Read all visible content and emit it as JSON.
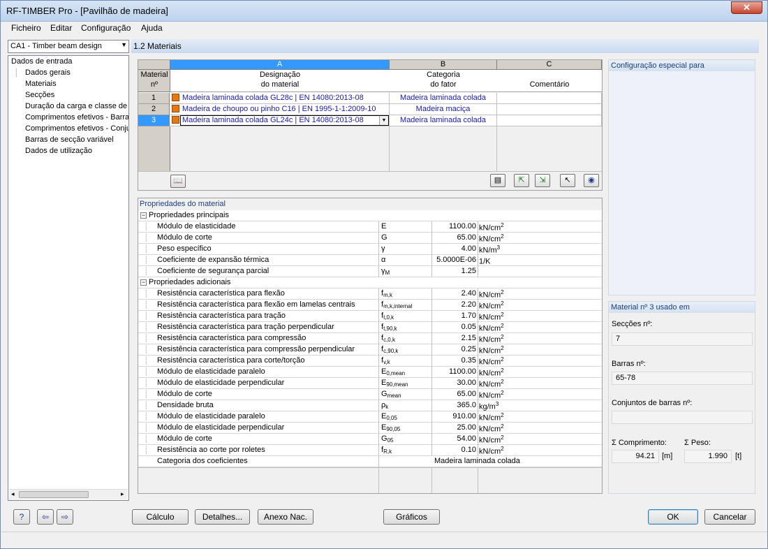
{
  "window": {
    "title": "RF-TIMBER Pro - [Pavilhão de madeira]"
  },
  "menu": [
    "Ficheiro",
    "Editar",
    "Configuração",
    "Ajuda"
  ],
  "nav": {
    "case": "CA1 - Timber beam design",
    "root": "Dados de entrada",
    "items": [
      "Dados gerais",
      "Materiais",
      "Secções",
      "Duração da carga e classe de u",
      "Comprimentos efetivos - Barras",
      "Comprimentos efetivos - Conju",
      "Barras de secção variável",
      "Dados de utilização"
    ]
  },
  "section_title": "1.2 Materiais",
  "grid": {
    "col_letters": [
      "A",
      "B",
      "C"
    ],
    "rownum_header": [
      "Material",
      "nº"
    ],
    "col_a_header": [
      "Designação",
      "do material"
    ],
    "col_b_header": [
      "Categoria",
      "do fator"
    ],
    "col_c_header": "Comentário",
    "rows": [
      {
        "num": "1",
        "material": "Madeira laminada colada GL28c | EN 14080:2013-08",
        "category": "Madeira laminada colada",
        "comment": ""
      },
      {
        "num": "2",
        "material": "Madeira de choupo ou pinho C16 | EN 1995-1-1:2009-10",
        "category": "Madeira maciça",
        "comment": ""
      },
      {
        "num": "3",
        "material": "Madeira laminada colada GL24c | EN 14080:2013-08",
        "category": "Madeira laminada colada",
        "comment": ""
      }
    ],
    "selected_row": 3,
    "swatch_color": "#e9770f"
  },
  "props": {
    "title": "Propriedades do material",
    "group_main": "Propriedades principais",
    "main": [
      {
        "name": "Módulo de elasticidade",
        "sym": "E",
        "sub": "",
        "value": "1100.00",
        "unit": "kN/cm",
        "exp": "2"
      },
      {
        "name": "Módulo de corte",
        "sym": "G",
        "sub": "",
        "value": "65.00",
        "unit": "kN/cm",
        "exp": "2"
      },
      {
        "name": "Peso específico",
        "sym": "γ",
        "sub": "",
        "value": "4.00",
        "unit": "kN/m",
        "exp": "3"
      },
      {
        "name": "Coeficiente de expansão térmica",
        "sym": "α",
        "sub": "",
        "value": "5.0000E-06",
        "unit": "1/K",
        "exp": ""
      },
      {
        "name": "Coeficiente de segurança parcial",
        "sym": "γ",
        "sub": "M",
        "value": "1.25",
        "unit": "",
        "exp": ""
      }
    ],
    "group_add": "Propriedades adicionais",
    "additional": [
      {
        "name": "Resistência característica para flexão",
        "sym": "f",
        "sub": "m,k",
        "value": "2.40",
        "unit": "kN/cm",
        "exp": "2"
      },
      {
        "name": "Resistência característica para flexão em lamelas centrais",
        "sym": "f",
        "sub": "m,k,internal",
        "value": "2.20",
        "unit": "kN/cm",
        "exp": "2"
      },
      {
        "name": "Resistência característica para tração",
        "sym": "f",
        "sub": "t,0,k",
        "value": "1.70",
        "unit": "kN/cm",
        "exp": "2"
      },
      {
        "name": "Resistência característica para tração perpendicular",
        "sym": "f",
        "sub": "t,90,k",
        "value": "0.05",
        "unit": "kN/cm",
        "exp": "2"
      },
      {
        "name": "Resistência característica para compressão",
        "sym": "f",
        "sub": "c,0,k",
        "value": "2.15",
        "unit": "kN/cm",
        "exp": "2"
      },
      {
        "name": "Resistência característica para compressão perpendicular",
        "sym": "f",
        "sub": "c,90,k",
        "value": "0.25",
        "unit": "kN/cm",
        "exp": "2"
      },
      {
        "name": "Resistência característica para corte/torção",
        "sym": "f",
        "sub": "v,k",
        "value": "0.35",
        "unit": "kN/cm",
        "exp": "2"
      },
      {
        "name": "Módulo de elasticidade paralelo",
        "sym": "E",
        "sub": "0,mean",
        "value": "1100.00",
        "unit": "kN/cm",
        "exp": "2"
      },
      {
        "name": "Módulo de elasticidade perpendicular",
        "sym": "E",
        "sub": "90,mean",
        "value": "30.00",
        "unit": "kN/cm",
        "exp": "2"
      },
      {
        "name": "Módulo de corte",
        "sym": "G",
        "sub": "mean",
        "value": "65.00",
        "unit": "kN/cm",
        "exp": "2"
      },
      {
        "name": "Densidade bruta",
        "sym": "ρ",
        "sub": "k",
        "value": "365.0",
        "unit": "kg/m",
        "exp": "3"
      },
      {
        "name": "Módulo de elasticidade paralelo",
        "sym": "E",
        "sub": "0,05",
        "value": "910.00",
        "unit": "kN/cm",
        "exp": "2"
      },
      {
        "name": "Módulo de elasticidade perpendicular",
        "sym": "E",
        "sub": "90,05",
        "value": "25.00",
        "unit": "kN/cm",
        "exp": "2"
      },
      {
        "name": "Módulo de corte",
        "sym": "G",
        "sub": "05",
        "value": "54.00",
        "unit": "kN/cm",
        "exp": "2"
      },
      {
        "name": "Resistência ao corte por roletes",
        "sym": "f",
        "sub": "R,k",
        "value": "0.10",
        "unit": "kN/cm",
        "exp": "2"
      }
    ],
    "category_row": {
      "name": "Categoria dos coeficientes",
      "value": "Madeira laminada colada"
    }
  },
  "right": {
    "config_title": "Configuração especial para",
    "usage_title": "Material nº 3 usado em",
    "sections_label": "Secções nº:",
    "sections_value": "7",
    "members_label": "Barras nº:",
    "members_value": "65-78",
    "sets_label": "Conjuntos de barras nº:",
    "sets_value": "",
    "length_label": "Σ Comprimento:",
    "length_value": "94.21",
    "length_unit": "[m]",
    "weight_label": "Σ Peso:",
    "weight_value": "1.990",
    "weight_unit": "[t]"
  },
  "buttons": {
    "calc": "Cálculo",
    "details": "Detalhes...",
    "annex": "Anexo Nac.",
    "graphics": "Gráficos",
    "ok": "OK",
    "cancel": "Cancelar"
  }
}
